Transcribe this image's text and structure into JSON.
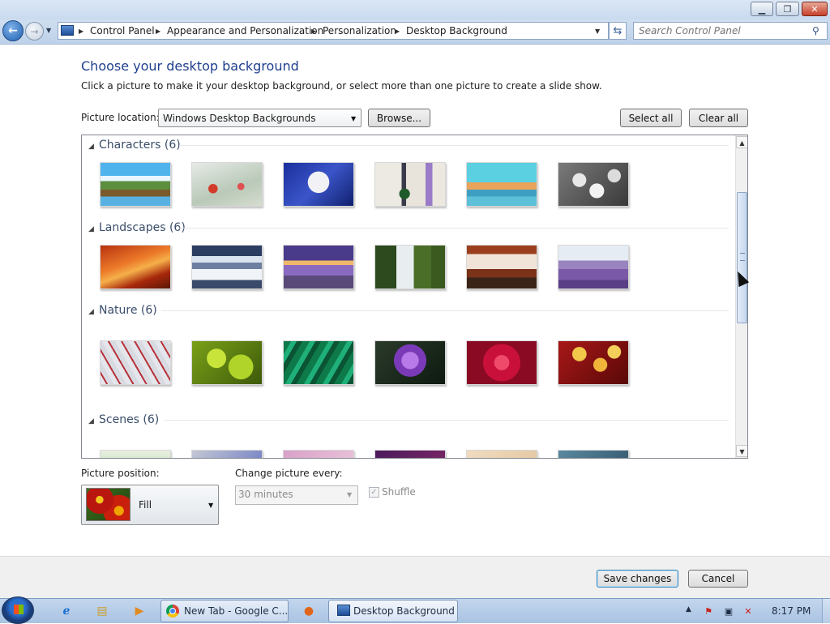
{
  "window": {
    "minimize_glyph": "▁",
    "maximize_glyph": "❐",
    "close_glyph": "✕"
  },
  "address_bar": {
    "breadcrumbs": [
      "Control Panel",
      "Appearance and Personalization",
      "Personalization",
      "Desktop Background"
    ],
    "search_placeholder": "Search Control Panel"
  },
  "content": {
    "title": "Choose your desktop background",
    "subtitle": "Click a picture to make it your desktop background, or select more than one picture to create a slide show.",
    "picture_location_label": "Picture location:",
    "picture_location_value": "Windows Desktop Backgrounds",
    "browse_label": "Browse...",
    "select_all_label": "Select all",
    "clear_all_label": "Clear all"
  },
  "gallery": {
    "groups": [
      {
        "name": "Characters (6)",
        "thumbnails": [
          "characters-1",
          "characters-2",
          "characters-3",
          "characters-4",
          "characters-5",
          "characters-6"
        ]
      },
      {
        "name": "Landscapes (6)",
        "thumbnails": [
          "landscapes-1",
          "landscapes-2",
          "landscapes-3",
          "landscapes-4",
          "landscapes-5",
          "landscapes-6"
        ]
      },
      {
        "name": "Nature (6)",
        "thumbnails": [
          "nature-1",
          "nature-2",
          "nature-3",
          "nature-4",
          "nature-5",
          "nature-6"
        ]
      },
      {
        "name": "Scenes (6)",
        "thumbnails": [
          "scenes-1",
          "scenes-2",
          "scenes-3",
          "scenes-4",
          "scenes-5",
          "scenes-6"
        ]
      }
    ]
  },
  "options": {
    "picture_position_label": "Picture position:",
    "picture_position_value": "Fill",
    "change_every_label": "Change picture every:",
    "change_every_value": "30 minutes",
    "shuffle_label": "Shuffle",
    "shuffle_checked": true
  },
  "footer": {
    "save_label": "Save changes",
    "cancel_label": "Cancel"
  },
  "taskbar": {
    "tasks": [
      {
        "label": "New Tab - Google C...",
        "icon": "chrome-icon"
      },
      {
        "label": "Desktop Background",
        "icon": "control-panel-icon"
      }
    ],
    "clock": "8:17 PM"
  },
  "colors": {
    "heading": "#1f3f8f",
    "titlebar": "#c9daef",
    "taskbar": "#a9c3e2",
    "default_button_border": "#3c7fb1"
  }
}
